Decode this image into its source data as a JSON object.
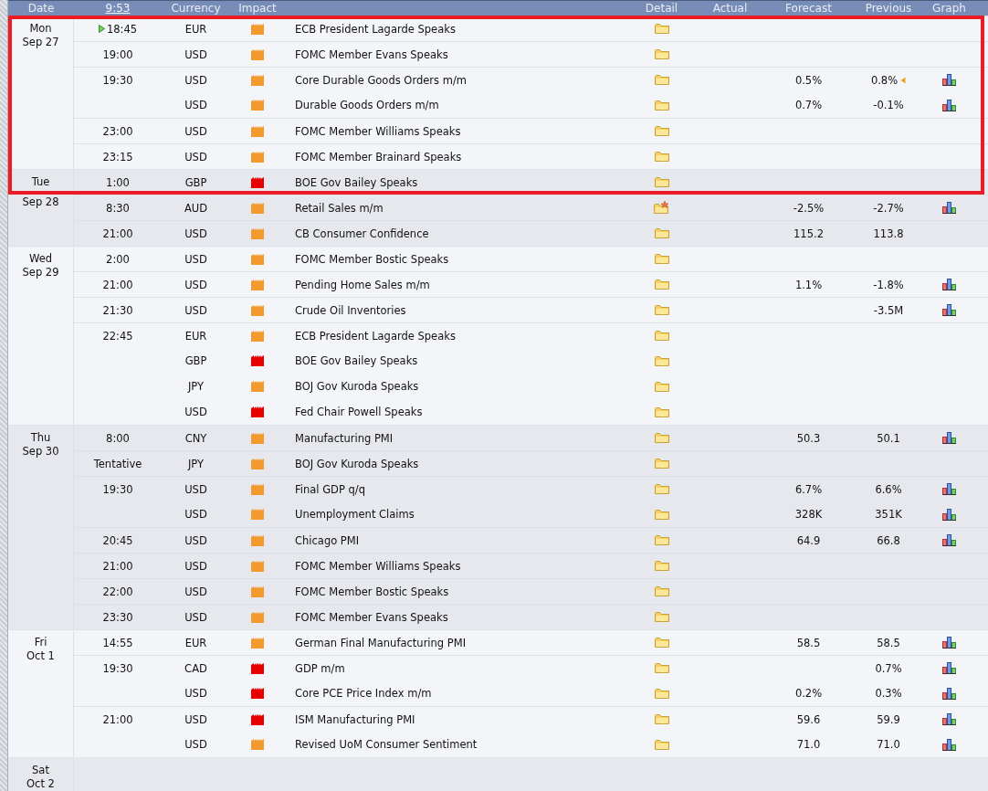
{
  "header": {
    "columns": [
      {
        "kind": "date",
        "label": "Date"
      },
      {
        "kind": "time",
        "label": "9:53"
      },
      {
        "kind": "currency",
        "label": "Currency"
      },
      {
        "kind": "impact",
        "label": "Impact"
      },
      {
        "kind": "event"
      },
      {
        "kind": "detail",
        "label": "Detail"
      },
      {
        "kind": "actual",
        "label": "Actual"
      },
      {
        "kind": "forecast",
        "label": "Forecast"
      },
      {
        "kind": "previous",
        "label": "Previous"
      },
      {
        "kind": "graph",
        "label": "Graph"
      }
    ]
  },
  "days": [
    {
      "day": "Mon",
      "date": "Sep 27",
      "groups": [
        {
          "time": "18:45",
          "upcoming": true,
          "events": [
            {
              "currency": "EUR",
              "color": "#f29a2e",
              "title": "ECB President Lagarde Speaks",
              "starred": false,
              "graph": false,
              "highlighted": true
            }
          ]
        },
        {
          "time": "19:00",
          "upcoming": false,
          "events": [
            {
              "currency": "USD",
              "color": "#f29a2e",
              "title": "FOMC Member Evans Speaks",
              "starred": false,
              "graph": false,
              "highlighted": true
            }
          ]
        },
        {
          "time": "19:30",
          "upcoming": false,
          "events": [
            {
              "currency": "USD",
              "color": "#f29a2e",
              "title": "Core Durable Goods Orders m/m",
              "starred": false,
              "forecast": "0.5%",
              "previous": "0.8%",
              "revised": true,
              "graph": true,
              "highlighted": true
            },
            {
              "currency": "USD",
              "color": "#f29a2e",
              "title": "Durable Goods Orders m/m",
              "starred": false,
              "forecast": "0.7%",
              "previous": "-0.1%",
              "revised": false,
              "graph": true,
              "highlighted": true
            }
          ]
        },
        {
          "time": "23:00",
          "upcoming": false,
          "events": [
            {
              "currency": "USD",
              "color": "#f29a2e",
              "title": "FOMC Member Williams Speaks",
              "starred": false,
              "graph": false,
              "highlighted": true
            }
          ]
        },
        {
          "time": "23:15",
          "upcoming": false,
          "events": [
            {
              "currency": "USD",
              "color": "#f29a2e",
              "title": "FOMC Member Brainard Speaks",
              "starred": false,
              "graph": false,
              "highlighted": true
            }
          ]
        }
      ]
    },
    {
      "day": "Tue",
      "date": "Sep 28",
      "groups": [
        {
          "time": "1:00",
          "upcoming": false,
          "events": [
            {
              "currency": "GBP",
              "color": "#e60000",
              "title": "BOE Gov Bailey Speaks",
              "starred": false,
              "graph": false,
              "highlighted": true
            }
          ]
        },
        {
          "time": "8:30",
          "upcoming": false,
          "events": [
            {
              "currency": "AUD",
              "color": "#f29a2e",
              "title": "Retail Sales m/m",
              "starred": true,
              "forecast": "-2.5%",
              "previous": "-2.7%",
              "revised": false,
              "graph": true,
              "highlighted": false
            }
          ]
        },
        {
          "time": "21:00",
          "upcoming": false,
          "events": [
            {
              "currency": "USD",
              "color": "#f29a2e",
              "title": "CB Consumer Confidence",
              "starred": false,
              "forecast": "115.2",
              "previous": "113.8",
              "revised": false,
              "graph": false,
              "highlighted": false
            }
          ]
        }
      ]
    },
    {
      "day": "Wed",
      "date": "Sep 29",
      "groups": [
        {
          "time": "2:00",
          "upcoming": false,
          "events": [
            {
              "currency": "USD",
              "color": "#f29a2e",
              "title": "FOMC Member Bostic Speaks",
              "starred": false,
              "graph": false,
              "highlighted": false
            }
          ]
        },
        {
          "time": "21:00",
          "upcoming": false,
          "events": [
            {
              "currency": "USD",
              "color": "#f29a2e",
              "title": "Pending Home Sales m/m",
              "starred": false,
              "forecast": "1.1%",
              "previous": "-1.8%",
              "revised": false,
              "graph": true,
              "highlighted": false
            }
          ]
        },
        {
          "time": "21:30",
          "upcoming": false,
          "events": [
            {
              "currency": "USD",
              "color": "#f29a2e",
              "title": "Crude Oil Inventories",
              "starred": false,
              "previous": "-3.5M",
              "revised": false,
              "graph": true,
              "highlighted": false
            }
          ]
        },
        {
          "time": "22:45",
          "upcoming": false,
          "events": [
            {
              "currency": "EUR",
              "color": "#f29a2e",
              "title": "ECB President Lagarde Speaks",
              "starred": false,
              "graph": false,
              "highlighted": false
            },
            {
              "currency": "GBP",
              "color": "#e60000",
              "title": "BOE Gov Bailey Speaks",
              "starred": false,
              "graph": false,
              "highlighted": false
            },
            {
              "currency": "JPY",
              "color": "#f29a2e",
              "title": "BOJ Gov Kuroda Speaks",
              "starred": false,
              "graph": false,
              "highlighted": false
            },
            {
              "currency": "USD",
              "color": "#e60000",
              "title": "Fed Chair Powell Speaks",
              "starred": false,
              "graph": false,
              "highlighted": false
            }
          ]
        }
      ]
    },
    {
      "day": "Thu",
      "date": "Sep 30",
      "groups": [
        {
          "time": "8:00",
          "upcoming": false,
          "events": [
            {
              "currency": "CNY",
              "color": "#f29a2e",
              "title": "Manufacturing PMI",
              "starred": false,
              "forecast": "50.3",
              "previous": "50.1",
              "revised": false,
              "graph": true,
              "highlighted": false
            }
          ]
        },
        {
          "time": "Tentative",
          "upcoming": false,
          "events": [
            {
              "currency": "JPY",
              "color": "#f29a2e",
              "title": "BOJ Gov Kuroda Speaks",
              "starred": false,
              "graph": false,
              "highlighted": false
            }
          ]
        },
        {
          "time": "19:30",
          "upcoming": false,
          "events": [
            {
              "currency": "USD",
              "color": "#f29a2e",
              "title": "Final GDP q/q",
              "starred": false,
              "forecast": "6.7%",
              "previous": "6.6%",
              "revised": false,
              "graph": true,
              "highlighted": false
            },
            {
              "currency": "USD",
              "color": "#f29a2e",
              "title": "Unemployment Claims",
              "starred": false,
              "forecast": "328K",
              "previous": "351K",
              "revised": false,
              "graph": true,
              "highlighted": false
            }
          ]
        },
        {
          "time": "20:45",
          "upcoming": false,
          "events": [
            {
              "currency": "USD",
              "color": "#f29a2e",
              "title": "Chicago PMI",
              "starred": false,
              "forecast": "64.9",
              "previous": "66.8",
              "revised": false,
              "graph": true,
              "highlighted": false
            }
          ]
        },
        {
          "time": "21:00",
          "upcoming": false,
          "events": [
            {
              "currency": "USD",
              "color": "#f29a2e",
              "title": "FOMC Member Williams Speaks",
              "starred": false,
              "graph": false,
              "highlighted": false
            }
          ]
        },
        {
          "time": "22:00",
          "upcoming": false,
          "events": [
            {
              "currency": "USD",
              "color": "#f29a2e",
              "title": "FOMC Member Bostic Speaks",
              "starred": false,
              "graph": false,
              "highlighted": false
            }
          ]
        },
        {
          "time": "23:30",
          "upcoming": false,
          "events": [
            {
              "currency": "USD",
              "color": "#f29a2e",
              "title": "FOMC Member Evans Speaks",
              "starred": false,
              "graph": false,
              "highlighted": false
            }
          ]
        }
      ]
    },
    {
      "day": "Fri",
      "date": "Oct 1",
      "groups": [
        {
          "time": "14:55",
          "upcoming": false,
          "events": [
            {
              "currency": "EUR",
              "color": "#f29a2e",
              "title": "German Final Manufacturing PMI",
              "starred": false,
              "forecast": "58.5",
              "previous": "58.5",
              "revised": false,
              "graph": true,
              "highlighted": false
            }
          ]
        },
        {
          "time": "19:30",
          "upcoming": false,
          "events": [
            {
              "currency": "CAD",
              "color": "#e60000",
              "title": "GDP m/m",
              "starred": false,
              "previous": "0.7%",
              "revised": false,
              "graph": true,
              "highlighted": false
            },
            {
              "currency": "USD",
              "color": "#e60000",
              "title": "Core PCE Price Index m/m",
              "starred": false,
              "forecast": "0.2%",
              "previous": "0.3%",
              "revised": false,
              "graph": true,
              "highlighted": false
            }
          ]
        },
        {
          "time": "21:00",
          "upcoming": false,
          "events": [
            {
              "currency": "USD",
              "color": "#e60000",
              "title": "ISM Manufacturing PMI",
              "starred": false,
              "forecast": "59.6",
              "previous": "59.9",
              "revised": false,
              "graph": true,
              "highlighted": false
            },
            {
              "currency": "USD",
              "color": "#f29a2e",
              "title": "Revised UoM Consumer Sentiment",
              "starred": false,
              "forecast": "71.0",
              "previous": "71.0",
              "revised": false,
              "graph": true,
              "highlighted": false
            }
          ]
        }
      ]
    },
    {
      "day": "Sat",
      "date": "Oct 2"
    }
  ]
}
